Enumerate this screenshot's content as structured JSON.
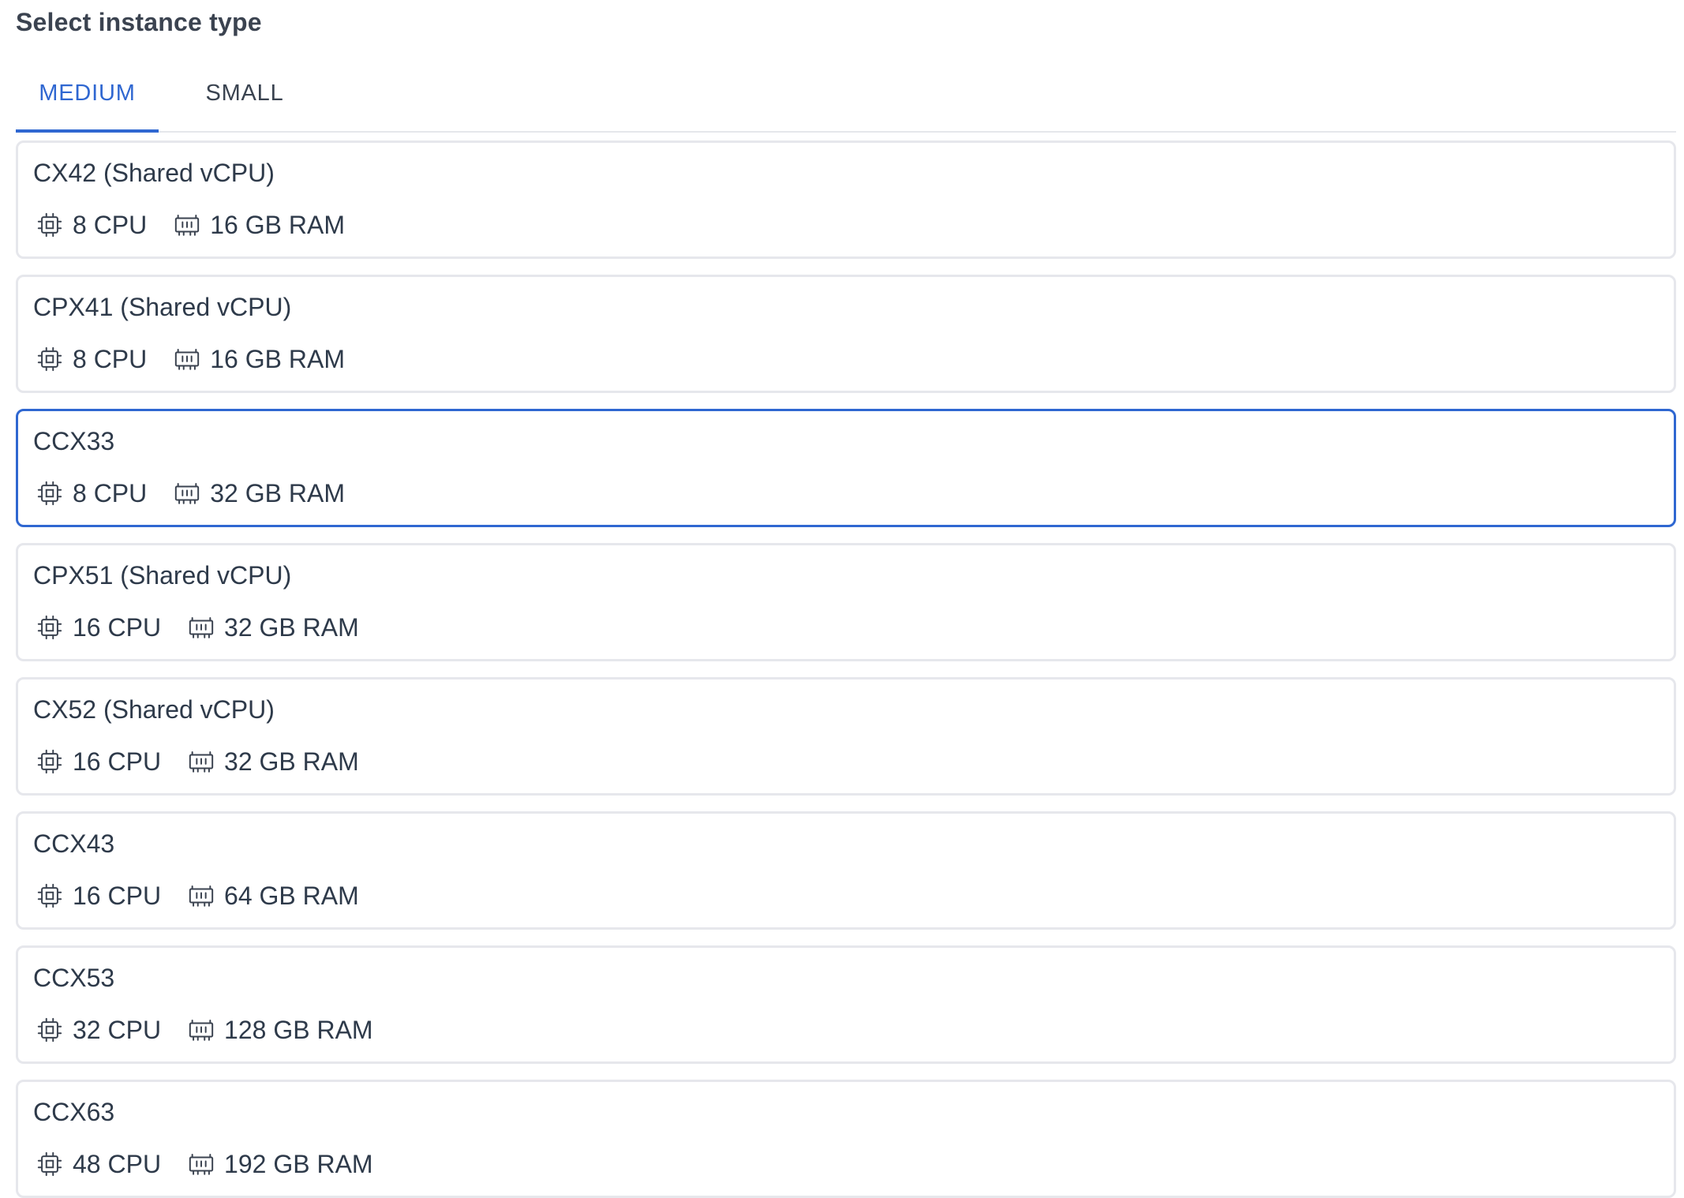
{
  "header": {
    "title": "Select instance type"
  },
  "tabs": [
    {
      "label": "MEDIUM",
      "active": true
    },
    {
      "label": "SMALL",
      "active": false
    }
  ],
  "accent_color": "#2f67d1",
  "instances": [
    {
      "name": "CX42 (Shared vCPU)",
      "cpu": "8 CPU",
      "ram": "16 GB RAM",
      "selected": false
    },
    {
      "name": "CPX41 (Shared vCPU)",
      "cpu": "8 CPU",
      "ram": "16 GB RAM",
      "selected": false
    },
    {
      "name": "CCX33",
      "cpu": "8 CPU",
      "ram": "32 GB RAM",
      "selected": true
    },
    {
      "name": "CPX51 (Shared vCPU)",
      "cpu": "16 CPU",
      "ram": "32 GB RAM",
      "selected": false
    },
    {
      "name": "CX52 (Shared vCPU)",
      "cpu": "16 CPU",
      "ram": "32 GB RAM",
      "selected": false
    },
    {
      "name": "CCX43",
      "cpu": "16 CPU",
      "ram": "64 GB RAM",
      "selected": false
    },
    {
      "name": "CCX53",
      "cpu": "32 CPU",
      "ram": "128 GB RAM",
      "selected": false
    },
    {
      "name": "CCX63",
      "cpu": "48 CPU",
      "ram": "192 GB RAM",
      "selected": false
    }
  ],
  "icons": {
    "cpu": "cpu-chip-icon",
    "ram": "memory-module-icon"
  }
}
